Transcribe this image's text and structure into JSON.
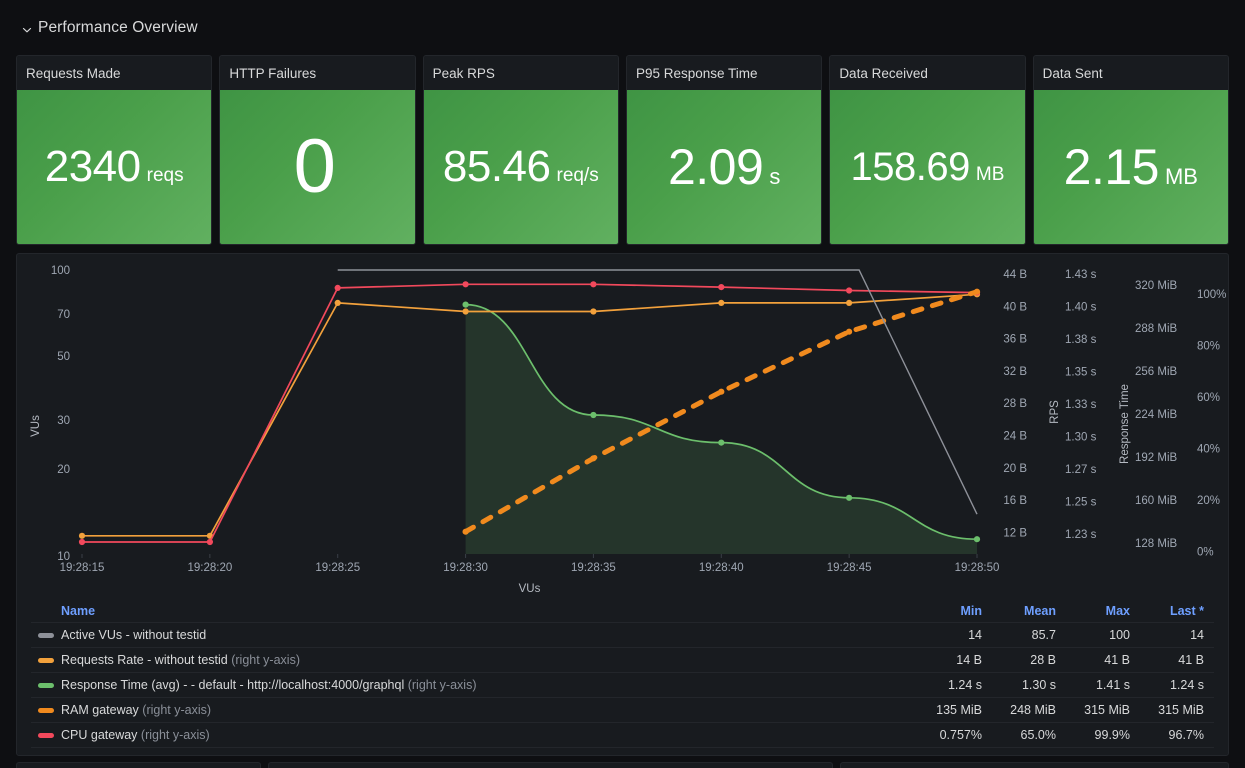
{
  "row": {
    "title": "Performance Overview",
    "collapse_icon": "chevron-down-icon"
  },
  "stats": [
    {
      "title": "Requests Made",
      "value": "2340",
      "unit": "reqs"
    },
    {
      "title": "HTTP Failures",
      "value": "0",
      "unit": ""
    },
    {
      "title": "Peak RPS",
      "value": "85.46",
      "unit": "req/s"
    },
    {
      "title": "P95 Response Time",
      "value": "2.09",
      "unit": "s"
    },
    {
      "title": "Data Received",
      "value": "158.69",
      "unit": "MB"
    },
    {
      "title": "Data Sent",
      "value": "2.15",
      "unit": "MB"
    }
  ],
  "legend": {
    "columns": [
      "Name",
      "Min",
      "Mean",
      "Max",
      "Last *"
    ],
    "rows": [
      {
        "color": "#8e9199",
        "name": "Active VUs - without testid",
        "axis_note": "",
        "min": "14",
        "mean": "85.7",
        "max": "100",
        "last": "14"
      },
      {
        "color": "#f2a13c",
        "name": "Requests Rate - without testid",
        "axis_note": " (right y-axis)",
        "min": "14 B",
        "mean": "28 B",
        "max": "41 B",
        "last": "41 B"
      },
      {
        "color": "#6cbf6c",
        "name": "Response Time (avg) - - default - http://localhost:4000/graphql",
        "axis_note": " (right y-axis)",
        "min": "1.24 s",
        "mean": "1.30 s",
        "max": "1.41 s",
        "last": "1.24 s"
      },
      {
        "color": "#f08a1e",
        "name": "RAM gateway",
        "axis_note": " (right y-axis)",
        "min": "135 MiB",
        "mean": "248 MiB",
        "max": "315 MiB",
        "last": "315 MiB"
      },
      {
        "color": "#f2495c",
        "name": "CPU gateway",
        "axis_note": " (right y-axis)",
        "min": "0.757%",
        "mean": "65.0%",
        "max": "99.9%",
        "last": "96.7%"
      }
    ]
  },
  "chart_data": {
    "type": "line",
    "title": "",
    "xlabel": "VUs",
    "grid": false,
    "legend_position": "bottom-table",
    "x": [
      "19:28:15",
      "19:28:20",
      "19:28:25",
      "19:28:30",
      "19:28:35",
      "19:28:40",
      "19:28:45",
      "19:28:50"
    ],
    "axes": [
      {
        "id": "left",
        "side": "left",
        "title": "VUs",
        "ticks": [
          "100",
          "70",
          "50",
          "30",
          "20",
          "10"
        ],
        "scale": "log",
        "range": [
          10,
          100
        ]
      },
      {
        "id": "rps-bytes",
        "side": "right",
        "title": "RPS",
        "ticks": [
          "44 B",
          "40 B",
          "36 B",
          "32 B",
          "28 B",
          "24 B",
          "20 B",
          "16 B",
          "12 B"
        ],
        "range": [
          12,
          44
        ],
        "unit": "B"
      },
      {
        "id": "response-time",
        "side": "right",
        "title": "Response Time",
        "ticks": [
          "1.43 s",
          "1.40 s",
          "1.38 s",
          "1.35 s",
          "1.33 s",
          "1.30 s",
          "1.27 s",
          "1.25 s",
          "1.23 s"
        ],
        "range": [
          1.23,
          1.43
        ],
        "unit": "s"
      },
      {
        "id": "memory",
        "side": "right",
        "title": "",
        "ticks": [
          "320 MiB",
          "288 MiB",
          "256 MiB",
          "224 MiB",
          "192 MiB",
          "160 MiB",
          "128 MiB"
        ],
        "range": [
          128,
          320
        ],
        "unit": "MiB"
      },
      {
        "id": "percent",
        "side": "right",
        "title": "",
        "ticks": [
          "100%",
          "80%",
          "60%",
          "40%",
          "20%",
          "0%"
        ],
        "range": [
          0,
          100
        ],
        "unit": "%"
      }
    ],
    "series": [
      {
        "name": "Active VUs - without testid",
        "color": "#8e9199",
        "axis": "left",
        "style": "solid",
        "fill": false,
        "points": false,
        "values": [
          null,
          null,
          100,
          100,
          100,
          100,
          100,
          14
        ]
      },
      {
        "name": "Requests Rate - without testid",
        "color": "#f2a13c",
        "axis": "rps-bytes",
        "style": "solid",
        "fill": false,
        "points": true,
        "values": [
          14,
          14,
          41,
          40,
          40,
          41,
          41,
          42
        ]
      },
      {
        "name": "Response Time (avg) - - default - http://localhost:4000/graphql",
        "color": "#6cbf6c",
        "axis": "response-time",
        "style": "solid",
        "fill": true,
        "points": true,
        "values": [
          null,
          null,
          null,
          1.41,
          1.33,
          1.31,
          1.27,
          1.24
        ]
      },
      {
        "name": "RAM gateway",
        "color": "#f08a1e",
        "axis": "memory",
        "style": "dashed",
        "fill": false,
        "points": true,
        "values": [
          null,
          null,
          null,
          135,
          190,
          240,
          285,
          315
        ]
      },
      {
        "name": "CPU gateway",
        "color": "#f2495c",
        "axis": "percent",
        "style": "solid",
        "fill": false,
        "points": true,
        "values": [
          0.757,
          0.757,
          98.5,
          99.9,
          99.9,
          98.8,
          97.5,
          96.7
        ]
      }
    ]
  }
}
